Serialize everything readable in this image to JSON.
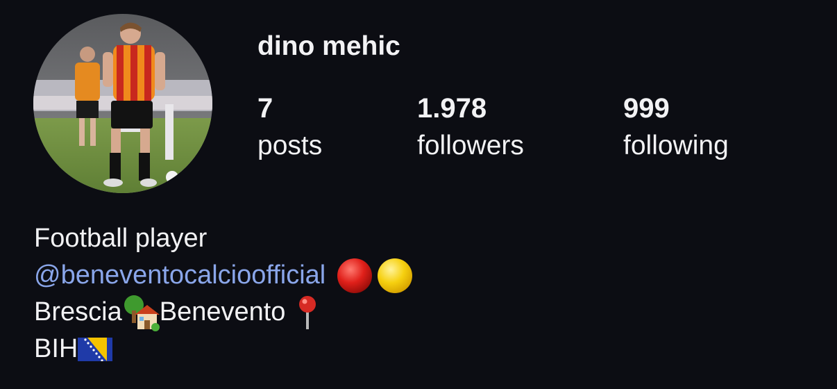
{
  "profile": {
    "username": "dino mehic",
    "avatar_alt": "profile-photo",
    "stats": {
      "posts": {
        "count": "7",
        "label": "posts"
      },
      "followers": {
        "count": "1.978",
        "label": "followers"
      },
      "following": {
        "count": "999",
        "label": "following"
      }
    }
  },
  "bio": {
    "line1": "Football player",
    "mention": "@beneventocalcioofficial",
    "line3_a": "Brescia",
    "line3_b": " Benevento",
    "line4": "BIH"
  },
  "colors": {
    "background": "#0c0d13",
    "text": "#f2f2f4",
    "mention": "#8aa6ea"
  },
  "icons": [
    "red-circle-icon",
    "yellow-circle-icon",
    "tree-house-icon",
    "pushpin-icon",
    "bosnia-flag-icon"
  ]
}
